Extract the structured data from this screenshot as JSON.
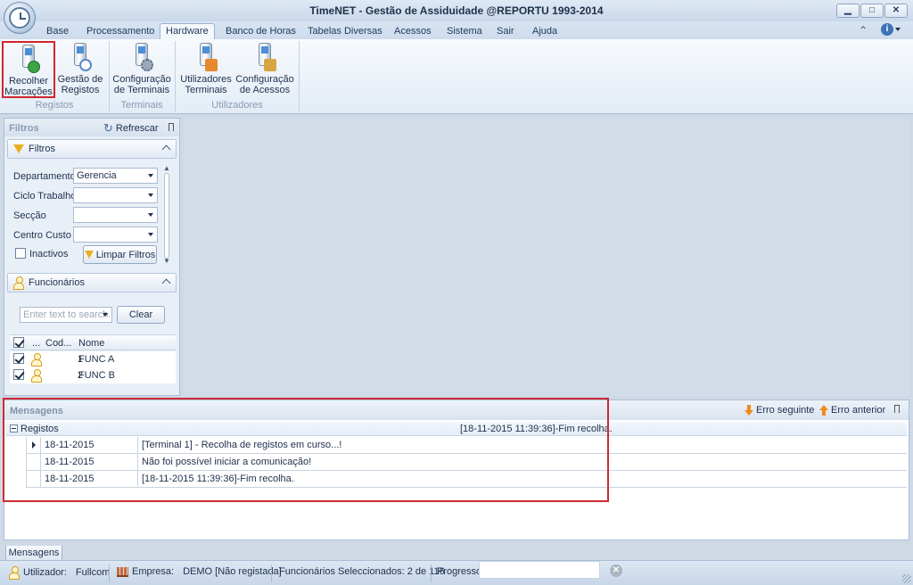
{
  "window": {
    "title": "TimeNET - Gestão de Assiduidade   @REPORTU 1993-2014",
    "minimize": "▁",
    "maximize": "□",
    "close": "✕"
  },
  "menu": {
    "tabs": [
      "Base",
      "Processamento",
      "Hardware",
      "Banco de Horas",
      "Tabelas Diversas",
      "Acessos",
      "Sistema",
      "Sair",
      "Ajuda"
    ],
    "active": "Hardware"
  },
  "ribbon": {
    "buttons": [
      {
        "line1": "Recolher",
        "line2": "Marcações",
        "icon": "device-download-icon"
      },
      {
        "line1": "Gestão de",
        "line2": "Registos",
        "icon": "device-search-icon"
      },
      {
        "line1": "Configuração",
        "line2": "de Terminais",
        "icon": "device-config-icon"
      },
      {
        "line1": "Utilizadores",
        "line2": "Terminais",
        "icon": "device-users-icon"
      },
      {
        "line1": "Configuração",
        "line2": "de Acessos",
        "icon": "device-access-icon"
      }
    ],
    "groups": [
      "Registos",
      "Terminais",
      "Utilizadores"
    ]
  },
  "filters_panel": {
    "title": "Filtros",
    "refresh_label": "Refrescar",
    "section_filters": "Filtros",
    "fields": [
      {
        "label": "Departamento",
        "value": "Gerencia"
      },
      {
        "label": "Ciclo Trabalho",
        "value": ""
      },
      {
        "label": "Secção",
        "value": ""
      },
      {
        "label": "Centro Custo",
        "value": ""
      }
    ],
    "inactive_label": "Inactivos",
    "clear_filters_label": "Limpar Filtros",
    "section_employees": "Funcionários",
    "search_placeholder": "Enter text to search...",
    "clear_label": "Clear",
    "grid_headers": {
      "dots": "...",
      "code": "Cod...",
      "name": "Nome"
    },
    "employees": [
      {
        "code": "1",
        "name": "FUNC A"
      },
      {
        "code": "2",
        "name": "FUNC B"
      }
    ]
  },
  "messages": {
    "title": "Mensagens",
    "next_error": "Erro seguinte",
    "prev_error": "Erro anterior",
    "group_label": "Registos",
    "group_summary": "[18-11-2015 11:39:36]-Fim recolha.",
    "rows": [
      {
        "date": "18-11-2015",
        "text": "[Terminal 1] - Recolha de registos em curso...!"
      },
      {
        "date": "18-11-2015",
        "text": "Não foi possível iniciar a comunicação!"
      },
      {
        "date": "18-11-2015",
        "text": "[18-11-2015 11:39:36]-Fim recolha."
      }
    ],
    "tab_label": "Mensagens"
  },
  "status": {
    "user_label": "Utilizador:",
    "user_value": "Fullcom",
    "company_label": "Empresa:",
    "company_value": "DEMO [Não registada]",
    "selected_label": "Funcionários Seleccionados: 2 de 116",
    "progress_label": "Progresso",
    "progress_value": 0
  },
  "colors": {
    "accent": "#cf2a33",
    "brand": "#1e395b",
    "arrow": "#f08a1a"
  }
}
